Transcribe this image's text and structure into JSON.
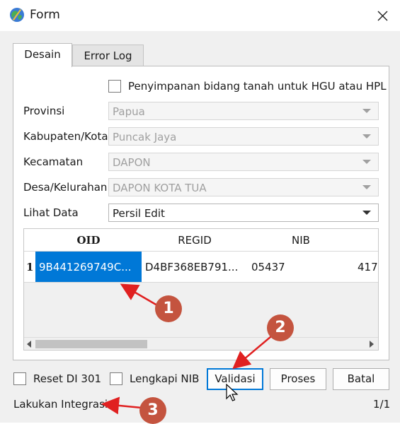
{
  "window": {
    "title": "Form"
  },
  "tabs": [
    {
      "label": "Desain"
    },
    {
      "label": "Error Log"
    }
  ],
  "form": {
    "hgu_checkbox_label": "Penyimpanan bidang tanah untuk HGU atau HPL",
    "provinsi": {
      "label": "Provinsi",
      "value": "Papua"
    },
    "kabupaten": {
      "label": "Kabupaten/Kota",
      "value": "Puncak Jaya"
    },
    "kecamatan": {
      "label": "Kecamatan",
      "value": "DAPON"
    },
    "desa": {
      "label": "Desa/Kelurahan",
      "value": "DAPON KOTA TUA"
    },
    "lihat_data": {
      "label": "Lihat Data",
      "value": "Persil Edit"
    }
  },
  "table": {
    "columns": [
      "OID",
      "REGID",
      "NIB",
      ""
    ],
    "rows": [
      {
        "num": "1",
        "cells": [
          "9B441269749C...",
          "D4BF368EB791...",
          "05437",
          "417"
        ]
      }
    ]
  },
  "bottom": {
    "reset_label": "Reset DI 301",
    "lengkapi_label": "Lengkapi NIB",
    "validasi": "Validasi",
    "proses": "Proses",
    "batal": "Batal",
    "status_text": "Lakukan Integrasi",
    "page_counter": "1/1"
  },
  "annotations": {
    "one": "1",
    "two": "2",
    "three": "3"
  },
  "colors": {
    "selection": "#0078d7",
    "annotation": "#c4543f",
    "arrow": "#e02020"
  }
}
